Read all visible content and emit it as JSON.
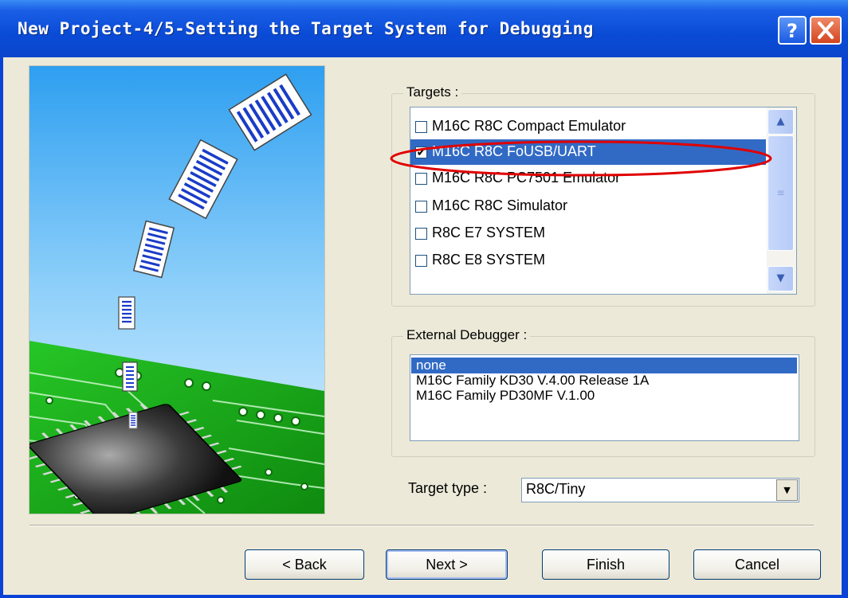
{
  "window": {
    "title": "New Project-4/5-Setting the Target System for Debugging",
    "help_icon": "?",
    "close_icon": "×"
  },
  "targets": {
    "label": "Targets :",
    "items": [
      {
        "label": "M16C R8C Compact Emulator",
        "checked": false,
        "selected": false
      },
      {
        "label": "M16C R8C FoUSB/UART",
        "checked": true,
        "selected": true
      },
      {
        "label": "M16C R8C PC7501 Emulator",
        "checked": false,
        "selected": false
      },
      {
        "label": "M16C R8C Simulator",
        "checked": false,
        "selected": false
      },
      {
        "label": "R8C E7 SYSTEM",
        "checked": false,
        "selected": false
      },
      {
        "label": "R8C E8 SYSTEM",
        "checked": false,
        "selected": false
      }
    ],
    "check_mark": "✔",
    "highlight_color": "#e00000"
  },
  "external_debugger": {
    "label": "External Debugger :",
    "items": [
      {
        "label": "none",
        "selected": true
      },
      {
        "label": "M16C Family KD30 V.4.00 Release 1A",
        "selected": false
      },
      {
        "label": "M16C Family PD30MF V.1.00",
        "selected": false
      }
    ]
  },
  "target_type": {
    "label": "Target type :",
    "value": "R8C/Tiny"
  },
  "buttons": {
    "back": "< Back",
    "next": "Next >",
    "finish": "Finish",
    "cancel": "Cancel"
  },
  "colors": {
    "title_bar": "#0a4bd6",
    "dialog_bg": "#ece9d8",
    "selection": "#316ac5"
  },
  "icons": {
    "scroll_up": "▲",
    "scroll_down": "▼",
    "dropdown": "▼",
    "scroll_grip": "≡"
  }
}
